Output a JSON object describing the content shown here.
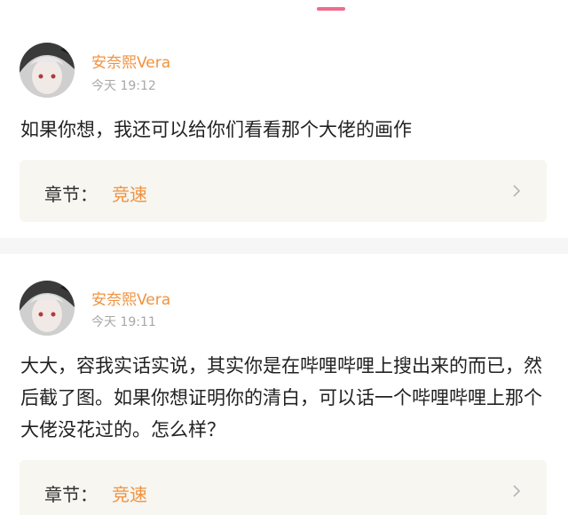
{
  "colors": {
    "accent_pink": "#f06b8f",
    "username_orange": "#f0923f",
    "chapter_value_orange": "#f0923f",
    "timestamp_gray": "#a8a8a8",
    "chapter_box_bg": "#f7f6f1"
  },
  "posts": [
    {
      "username": "安奈熙Vera",
      "timestamp": "今天 19:12",
      "text": "如果你想，我还可以给你们看看那个大佬的画作",
      "chapter_label": "章节：",
      "chapter_value": "竞速",
      "chevron_icon": "chevron-right-icon"
    },
    {
      "username": "安奈熙Vera",
      "timestamp": "今天 19:11",
      "text": "大大，容我实话实说，其实你是在哔哩哔哩上搜出来的而已，然后截了图。如果你想证明你的清白，可以话一个哔哩哔哩上那个大佬没花过的。怎么样？",
      "chapter_label": "章节：",
      "chapter_value": "竞速",
      "chevron_icon": "chevron-right-icon"
    }
  ]
}
